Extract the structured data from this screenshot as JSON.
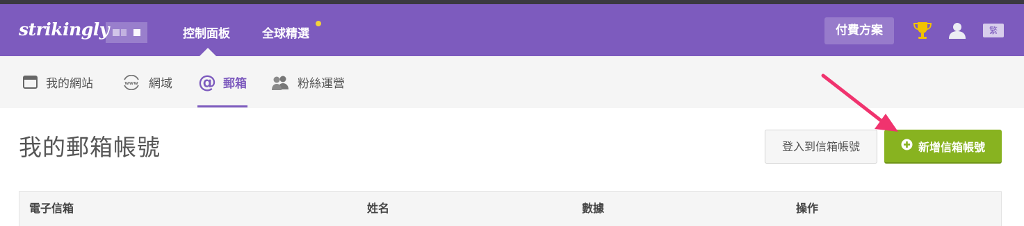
{
  "app": {
    "logo_text": "strikingly",
    "brand_color": "#7d5bbe"
  },
  "topnav": {
    "items": [
      {
        "label": "控制面板"
      },
      {
        "label": "全球精選"
      }
    ],
    "paid_plan_label": "付費方案",
    "lang_label": "繁"
  },
  "subnav": {
    "items": [
      {
        "label": "我的網站",
        "icon": "browser-window-icon"
      },
      {
        "label": "網域",
        "icon": "www-globe-icon"
      },
      {
        "label": "郵箱",
        "icon": "at-sign-icon"
      },
      {
        "label": "粉絲運營",
        "icon": "users-icon"
      }
    ],
    "active_index": 2
  },
  "main": {
    "title": "我的郵箱帳號",
    "login_button_label": "登入到信箱帳號",
    "add_button_label": "新增信箱帳號",
    "add_button_color": "#88b320"
  },
  "table": {
    "columns": [
      "電子信箱",
      "姓名",
      "數據",
      "操作"
    ]
  }
}
